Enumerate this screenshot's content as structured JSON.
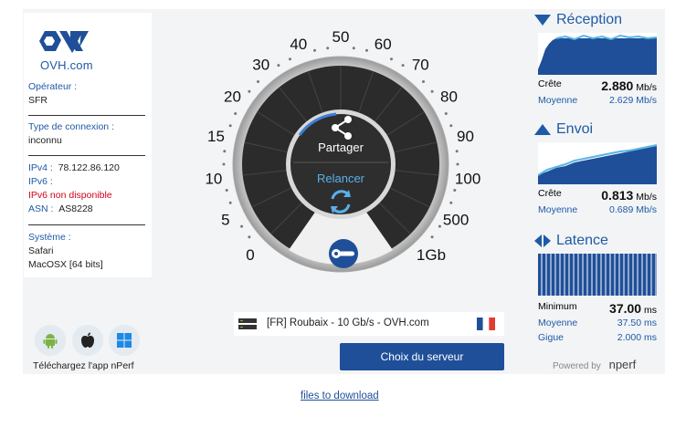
{
  "brand": {
    "logo_text": "OVH.com"
  },
  "info": {
    "operator_label": "Opérateur :",
    "operator_value": "SFR",
    "conn_label": "Type de connexion :",
    "conn_value": "inconnu",
    "ipv4_label": "IPv4 :",
    "ipv4_value": "78.122.86.120",
    "ipv6_label": "IPv6 :",
    "ipv6_value": "IPv6 non disponible",
    "asn_label": "ASN :",
    "asn_value": "AS8228",
    "system_label": "Système :",
    "system_browser": "Safari",
    "system_os": "MacOSX [64 bits]"
  },
  "apps": {
    "caption": "Téléchargez l'app nPerf",
    "icons": [
      "android-icon",
      "apple-icon",
      "windows-icon"
    ]
  },
  "gauge": {
    "share_label": "Partager",
    "restart_label": "Relancer",
    "ticks": [
      "0",
      "5",
      "10",
      "15",
      "20",
      "30",
      "40",
      "50",
      "60",
      "70",
      "80",
      "90",
      "100",
      "500",
      "1Gb"
    ]
  },
  "server": {
    "label": "[FR] Roubaix - 10 Gb/s - OVH.com",
    "button_label": "Choix du serveur"
  },
  "reception": {
    "title": "Réception",
    "peak_label": "Crête",
    "peak_value": "2.880",
    "peak_unit": "Mb/s",
    "avg_label": "Moyenne",
    "avg_value": "2.629 Mb/s"
  },
  "envoi": {
    "title": "Envoi",
    "peak_label": "Crête",
    "peak_value": "0.813",
    "peak_unit": "Mb/s",
    "avg_label": "Moyenne",
    "avg_value": "0.689 Mb/s"
  },
  "latence": {
    "title": "Latence",
    "min_label": "Minimum",
    "min_value": "37.00",
    "min_unit": "ms",
    "avg_label": "Moyenne",
    "avg_value": "37.50 ms",
    "jitter_label": "Gigue",
    "jitter_value": "2.000 ms"
  },
  "footer": {
    "powered_label": "Powered by",
    "powered_brand": "nperf",
    "files_link": "files to download"
  },
  "colors": {
    "accent": "#1f5aa6",
    "button": "#1f4f99",
    "gauge_dark": "#2b2b2b",
    "graph_fill": "#1f4f99",
    "graph_top": "#59b6e6"
  }
}
